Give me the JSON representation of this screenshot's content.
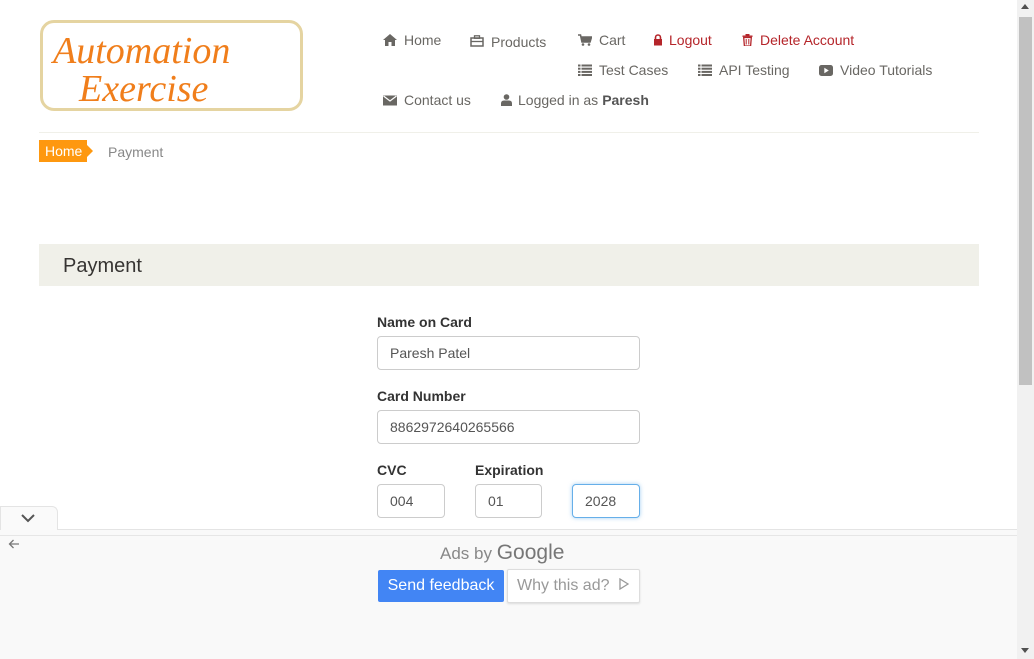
{
  "brand": {
    "logo_word1": "Automation",
    "logo_word2": "Exercise",
    "accent_color": "#FE980F"
  },
  "nav": {
    "home": {
      "label": "Home",
      "icon": "home-icon"
    },
    "products": {
      "label": "Products",
      "icon": "products-icon"
    },
    "cart": {
      "label": "Cart",
      "icon": "cart-icon"
    },
    "logout": {
      "label": "Logout",
      "icon": "lock-icon"
    },
    "delete_account": {
      "label": "Delete Account",
      "icon": "trash-icon"
    },
    "test_cases": {
      "label": "Test Cases",
      "icon": "list-icon"
    },
    "api_testing": {
      "label": "API Testing",
      "icon": "list-icon"
    },
    "video_tutorials": {
      "label": "Video Tutorials",
      "icon": "youtube-icon"
    },
    "contact_us": {
      "label": "Contact us",
      "icon": "envelope-icon"
    },
    "logged_in_prefix": "Logged in as",
    "logged_in_user": "Paresh"
  },
  "breadcrumb": {
    "home": "Home",
    "current": "Payment"
  },
  "payment": {
    "heading": "Payment",
    "name_label": "Name on Card",
    "name_value": "Paresh Patel",
    "number_label": "Card Number",
    "number_value": "8862972640265566",
    "cvc_label": "CVC",
    "cvc_value": "004",
    "expiration_label": "Expiration",
    "exp_month_value": "01",
    "exp_year_value": "2028"
  },
  "ad": {
    "ads_by": "Ads by",
    "google": "Google",
    "send_feedback": "Send feedback",
    "why_this_ad": "Why this ad?"
  }
}
